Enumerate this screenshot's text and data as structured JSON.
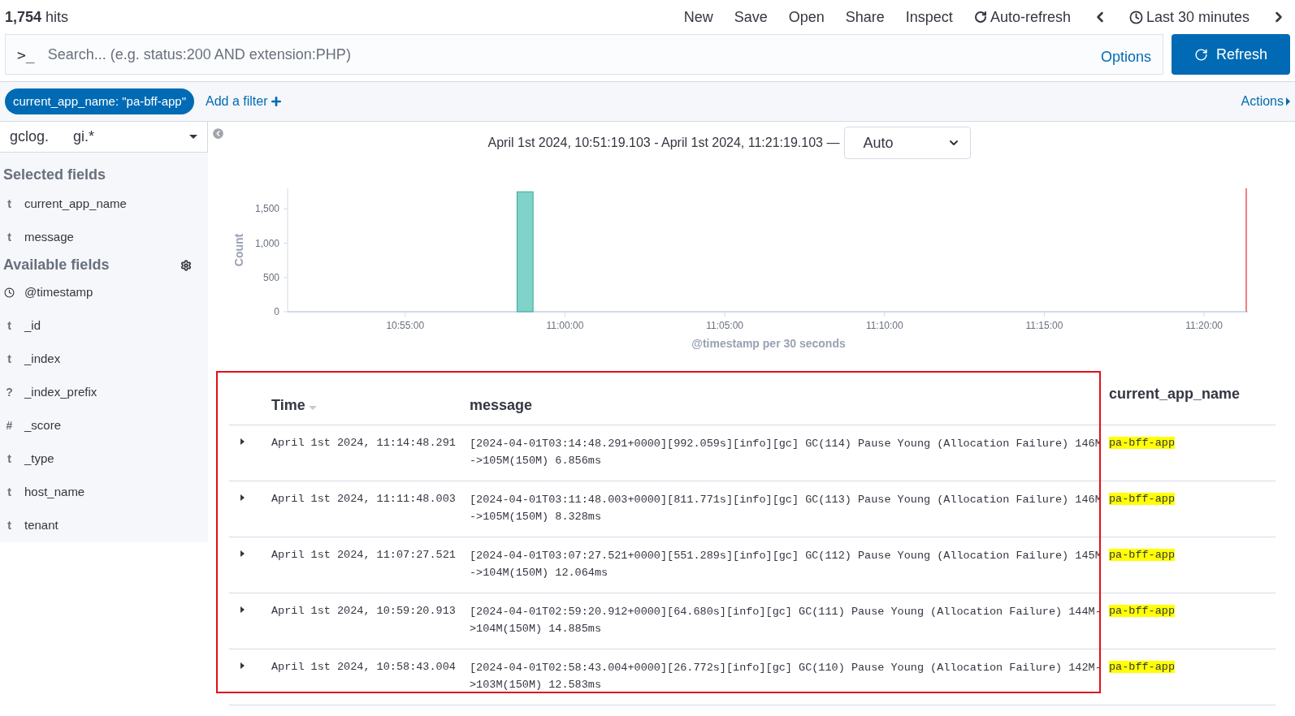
{
  "hits": {
    "count": "1,754",
    "label": "hits"
  },
  "menu": [
    {
      "label": "New",
      "kind": "text"
    },
    {
      "label": "Save",
      "kind": "text"
    },
    {
      "label": "Open",
      "kind": "text"
    },
    {
      "label": "Share",
      "kind": "text"
    },
    {
      "label": "Inspect",
      "kind": "text"
    },
    {
      "label": "Auto-refresh",
      "kind": "refresh"
    }
  ],
  "time_picker": {
    "label": "Last 30 minutes"
  },
  "search": {
    "prompt": ">_",
    "placeholder": "Search... (e.g. status:200 AND extension:PHP)",
    "options": "Options",
    "refresh": "Refresh"
  },
  "filters": [
    {
      "label": "current_app_name: \"pa-bff-app\""
    }
  ],
  "add_filter": "Add a filter",
  "actions": "Actions",
  "index_pattern": "gclog.      gi.*",
  "sidebar": {
    "selected_title": "Selected fields",
    "selected": [
      {
        "kind": "type",
        "type": "t",
        "name": "current_app_name"
      },
      {
        "kind": "type",
        "type": "t",
        "name": "message"
      }
    ],
    "available_title": "Available fields",
    "available": [
      {
        "kind": "clock",
        "name": "@timestamp"
      },
      {
        "kind": "type",
        "type": "t",
        "name": "_id"
      },
      {
        "kind": "type",
        "type": "t",
        "name": "_index"
      },
      {
        "kind": "type",
        "type": "?",
        "name": "_index_prefix"
      },
      {
        "kind": "type",
        "type": "#",
        "name": "_score"
      },
      {
        "kind": "type",
        "type": "t",
        "name": "_type"
      },
      {
        "kind": "type",
        "type": "t",
        "name": "host_name"
      },
      {
        "kind": "type",
        "type": "t",
        "name": "tenant"
      }
    ]
  },
  "range": {
    "text": "April 1st 2024, 10:51:19.103 - April 1st 2024, 11:21:19.103 —",
    "interval": "Auto"
  },
  "chart_data": {
    "type": "bar",
    "xlabel": "@timestamp per 30 seconds",
    "ylabel": "Count",
    "categories": [
      null,
      null,
      null,
      null,
      null,
      null,
      null,
      null,
      "10:55:00",
      null,
      null,
      null,
      null,
      null,
      null,
      null,
      null,
      null,
      "11:00:00",
      null,
      null,
      null,
      null,
      null,
      null,
      null,
      null,
      null,
      "11:05:00",
      null,
      null,
      null,
      null,
      null,
      null,
      null,
      null,
      null,
      "11:10:00",
      null,
      null,
      null,
      null,
      null,
      null,
      null,
      null,
      null,
      "11:15:00",
      null,
      null,
      null,
      null,
      null,
      null,
      null,
      null,
      null,
      "11:20:00",
      null,
      null
    ],
    "values": [
      0,
      0,
      0,
      0,
      0,
      0,
      0,
      0,
      0,
      0,
      0,
      0,
      0,
      0,
      0,
      1750,
      0,
      0,
      0,
      0,
      0,
      0,
      0,
      0,
      0,
      0,
      0,
      0,
      0,
      0,
      0,
      0,
      0,
      0,
      0,
      0,
      0,
      0,
      0,
      0,
      0,
      0,
      0,
      0,
      0,
      0,
      0,
      0,
      0,
      0,
      0,
      0,
      0,
      0,
      0,
      0,
      0,
      0,
      0,
      0,
      0
    ],
    "ylim": [
      0,
      1800
    ],
    "yticks": [
      {
        "value": 0,
        "label": "0"
      },
      {
        "value": 500,
        "label": "500"
      },
      {
        "value": 1000,
        "label": "1,000"
      },
      {
        "value": 1500,
        "label": "1,500"
      }
    ]
  },
  "table": {
    "columns": [
      "Time",
      "message",
      "current_app_name"
    ],
    "rows": [
      {
        "time": "April 1st 2024, 11:14:48.291",
        "message": "[2024-04-01T03:14:48.291+0000][992.059s][info][gc] GC(114) Pause Young (Allocation Failure) 146M->105M(150M) 6.856ms",
        "app": "pa-bff-app"
      },
      {
        "time": "April 1st 2024, 11:11:48.003",
        "message": "[2024-04-01T03:11:48.003+0000][811.771s][info][gc] GC(113) Pause Young (Allocation Failure) 146M->105M(150M) 8.328ms",
        "app": "pa-bff-app"
      },
      {
        "time": "April 1st 2024, 11:07:27.521",
        "message": "[2024-04-01T03:07:27.521+0000][551.289s][info][gc] GC(112) Pause Young (Allocation Failure) 145M->104M(150M) 12.064ms",
        "app": "pa-bff-app"
      },
      {
        "time": "April 1st 2024, 10:59:20.913",
        "message": "[2024-04-01T02:59:20.912+0000][64.680s][info][gc] GC(111) Pause Young (Allocation Failure) 144M->104M(150M) 14.885ms",
        "app": "pa-bff-app"
      },
      {
        "time": "April 1st 2024, 10:58:43.004",
        "message": "[2024-04-01T02:58:43.004+0000][26.772s][info][gc] GC(110) Pause Young (Allocation Failure) 142M->103M(150M) 12.583ms",
        "app": "pa-bff-app"
      }
    ]
  }
}
